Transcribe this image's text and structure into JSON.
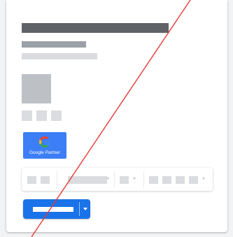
{
  "colors": {
    "page_background": "#f1f3f4",
    "card_background": "#ffffff",
    "title_placeholder": "#5f6368",
    "subtitle_placeholder": "#9aa0a6",
    "text_placeholder": "#dadce0",
    "thumbnail_placeholder": "#bdc1c6",
    "badge_background": "#3c7ef6",
    "primary_button": "#1a73e8",
    "overlay_line": "#e53935"
  },
  "badge": {
    "icon": "google-g-icon",
    "label": "Google Partner"
  },
  "toolbar": {
    "icons": [
      "chevron-down-icon"
    ]
  },
  "primary_action": {
    "icon": "chevron-down-icon"
  },
  "overlay": {
    "type": "diagonal-strike-line"
  }
}
